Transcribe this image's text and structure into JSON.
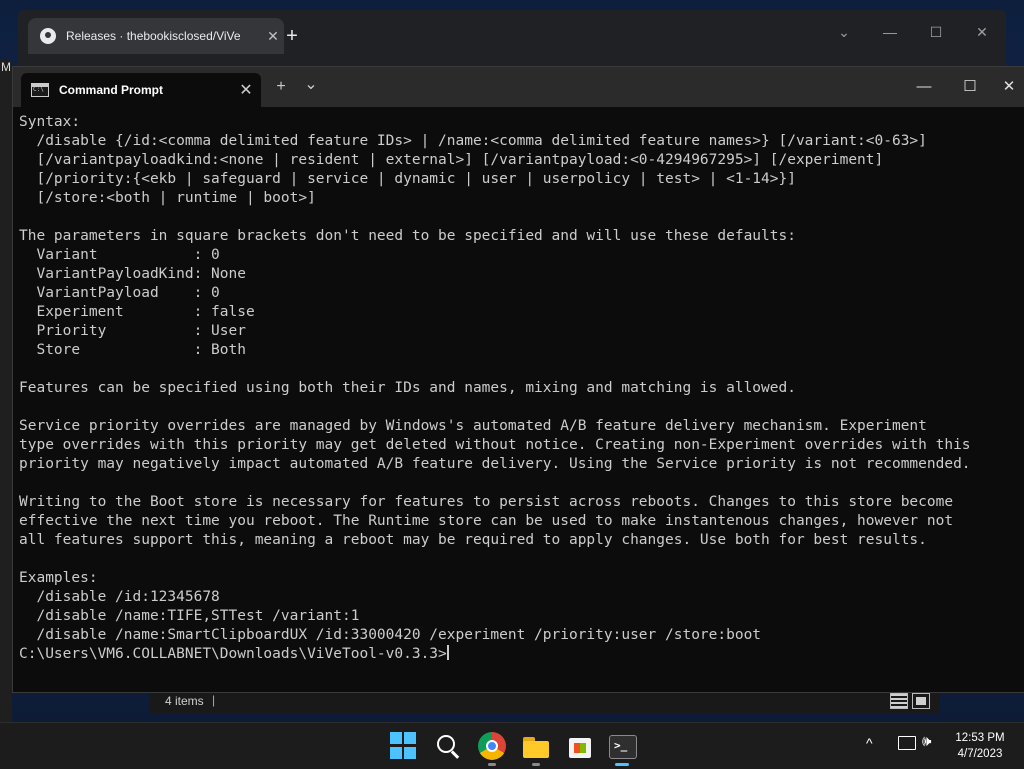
{
  "browser": {
    "tab_title": "Releases · thebookisclosed/ViVe",
    "tab_close": "✕",
    "new_tab": "+",
    "dropdown": "⌄",
    "minimize": "—",
    "maximize": "☐",
    "close": "✕",
    "sliver_text": "M"
  },
  "terminal": {
    "tab_title": "Command Prompt",
    "tab_close": "✕",
    "new_tab": "+",
    "dropdown": "⌄",
    "minimize": "—",
    "maximize": "☐",
    "close": "✕",
    "output": "Syntax:\n  /disable {/id:<comma delimited feature IDs> | /name:<comma delimited feature names>} [/variant:<0-63>]\n  [/variantpayloadkind:<none | resident | external>] [/variantpayload:<0-4294967295>] [/experiment]\n  [/priority:{<ekb | safeguard | service | dynamic | user | userpolicy | test> | <1-14>}]\n  [/store:<both | runtime | boot>]\n\nThe parameters in square brackets don't need to be specified and will use these defaults:\n  Variant           : 0\n  VariantPayloadKind: None\n  VariantPayload    : 0\n  Experiment        : false\n  Priority          : User\n  Store             : Both\n\nFeatures can be specified using both their IDs and names, mixing and matching is allowed.\n\nService priority overrides are managed by Windows's automated A/B feature delivery mechanism. Experiment\ntype overrides with this priority may get deleted without notice. Creating non-Experiment overrides with this\npriority may negatively impact automated A/B feature delivery. Using the Service priority is not recommended.\n\nWriting to the Boot store is necessary for features to persist across reboots. Changes to this store become\neffective the next time you reboot. The Runtime store can be used to make instantenous changes, however not\nall features support this, meaning a reboot may be required to apply changes. Use both for best results.\n\nExamples:\n  /disable /id:12345678\n  /disable /name:TIFE,STTest /variant:1\n  /disable /name:SmartClipboardUX /id:33000420 /experiment /priority:user /store:boot\n",
    "prompt": "C:\\Users\\VM6.COLLABNET\\Downloads\\ViVeTool-v0.3.3>"
  },
  "explorer_status": {
    "item_count": "4 items",
    "separator": "|"
  },
  "taskbar": {
    "apps": [
      "start-icon",
      "search-icon",
      "chrome-icon",
      "file-explorer-icon",
      "store-icon",
      "terminal-icon"
    ],
    "tray_chevron": "^",
    "volume": "🕪",
    "time": "12:53 PM",
    "date": "4/7/2023"
  },
  "colors": {
    "terminal_bg": "#0c0c0c",
    "terminal_text": "#cccccc",
    "titlebar": "#2b2b2b",
    "taskbar": "#1c1c1c",
    "accent": "#4cc2ff"
  }
}
